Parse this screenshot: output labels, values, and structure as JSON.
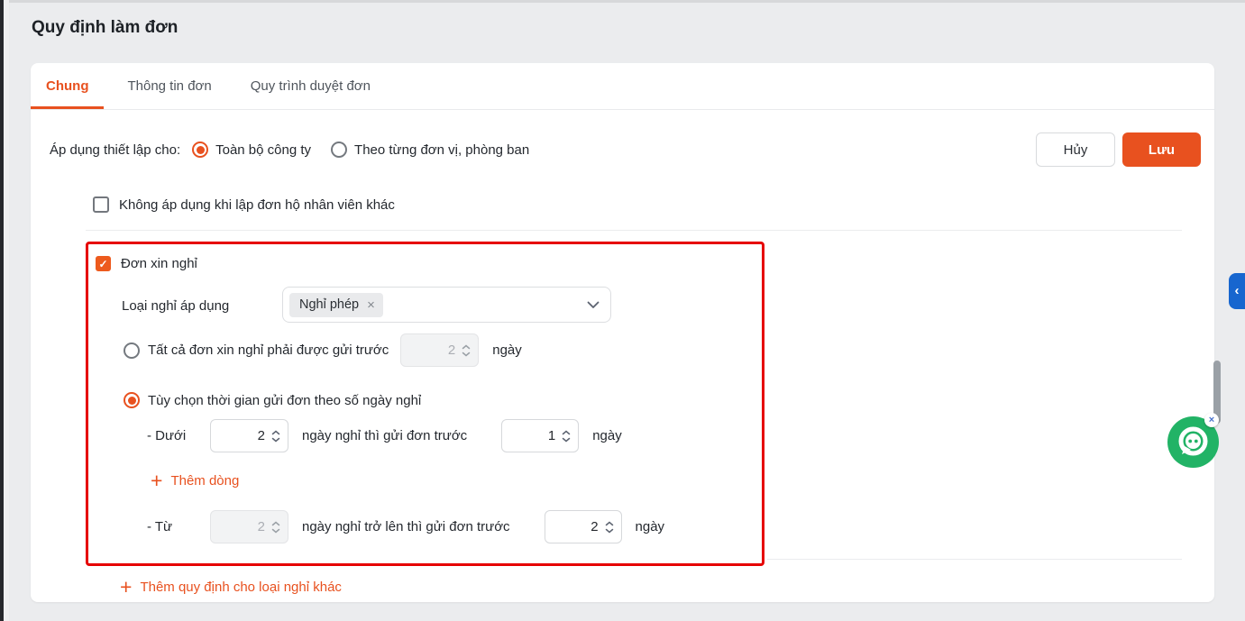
{
  "header": {
    "title": "Quy định làm đơn"
  },
  "tabs": [
    {
      "label": "Chung",
      "active": true
    },
    {
      "label": "Thông tin đơn",
      "active": false
    },
    {
      "label": "Quy trình duyệt đơn",
      "active": false
    }
  ],
  "apply_settings": {
    "label": "Áp dụng thiết lập cho:",
    "options": [
      {
        "label": "Toàn bộ công ty",
        "selected": true
      },
      {
        "label": "Theo từng đơn vị, phòng ban",
        "selected": false
      }
    ]
  },
  "actions": {
    "cancel_label": "Hủy",
    "save_label": "Lưu"
  },
  "general_checkbox": {
    "label": "Không áp dụng khi lập đơn hộ nhân viên khác",
    "checked": false
  },
  "leave_section": {
    "title_checkbox": {
      "label": "Đơn xin nghỉ",
      "checked": true
    },
    "leave_type": {
      "label": "Loại nghỉ áp dụng",
      "selected_tag": "Nghỉ phép"
    },
    "rule_fixed": {
      "selected": false,
      "label": "Tất cả đơn xin nghỉ phải được gửi trước",
      "value": "2",
      "unit": "ngày",
      "input_disabled": true
    },
    "rule_custom": {
      "selected": true,
      "label": "Tùy chọn thời gian gửi đơn theo số ngày nghỉ"
    },
    "row_under": {
      "prefix": "- Dưới",
      "days": "2",
      "middle_text": "ngày nghỉ thì gửi đơn trước",
      "send_before": "1",
      "unit": "ngày"
    },
    "add_row": {
      "label": "Thêm dòng"
    },
    "row_from": {
      "prefix": "- Từ",
      "days": "2",
      "days_disabled": true,
      "middle_text": "ngày nghỉ trở lên thì gửi đơn trước",
      "send_before": "2",
      "unit": "ngày"
    },
    "add_rule": {
      "label": "Thêm quy định cho loại nghỉ khác"
    }
  },
  "icons": {
    "check": "✓",
    "plus": "+",
    "tag_close": "×",
    "collapse_chevron": "‹",
    "chat_close": "×"
  },
  "colors": {
    "accent_orange": "#E8511F",
    "annotation_red": "#E60000",
    "collapse_blue": "#1766CF",
    "chat_green": "#22B366"
  }
}
